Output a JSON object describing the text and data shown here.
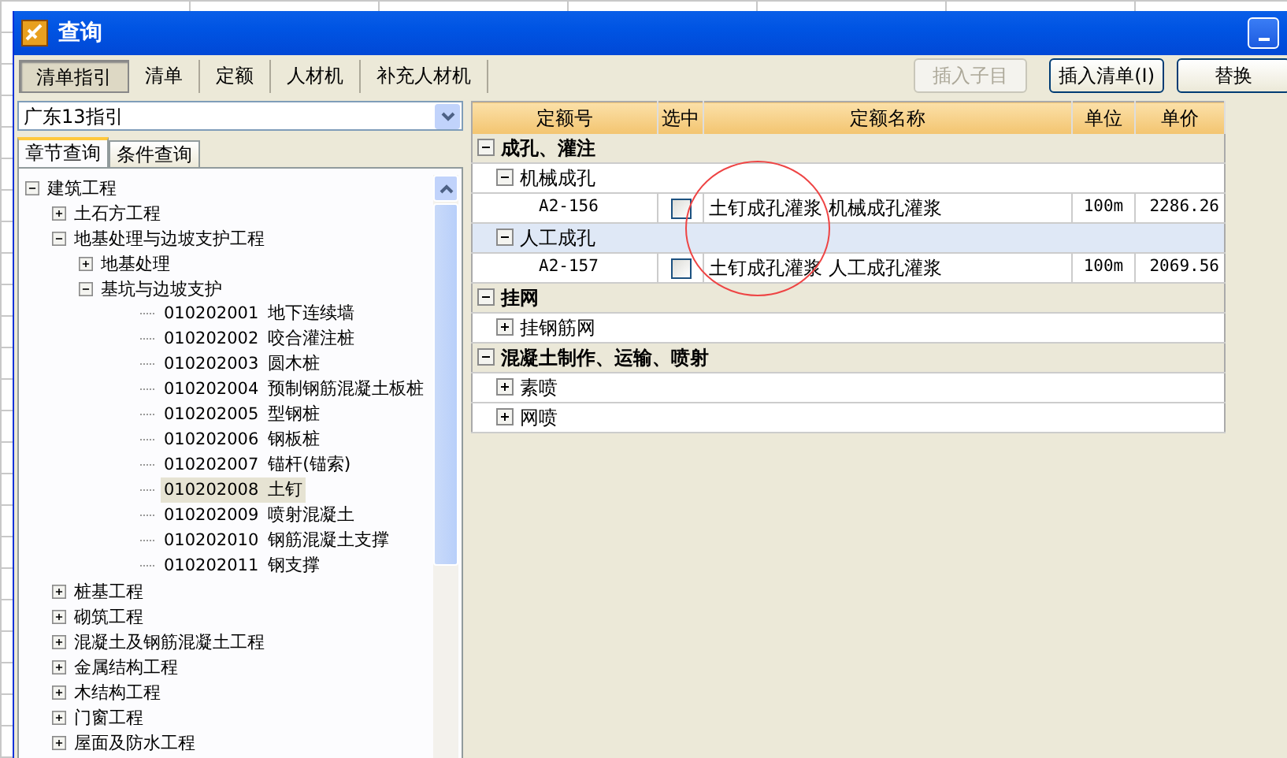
{
  "window": {
    "title": "查询"
  },
  "toolbar_tabs": [
    {
      "label": "清单指引",
      "selected": true
    },
    {
      "label": "清单",
      "selected": false
    },
    {
      "label": "定额",
      "selected": false
    },
    {
      "label": "人材机",
      "selected": false
    },
    {
      "label": "补充人材机",
      "selected": false
    }
  ],
  "toolbar_buttons": [
    {
      "label": "插入子目",
      "disabled": true
    },
    {
      "label": "插入清单(I)",
      "disabled": false
    },
    {
      "label": "替换",
      "disabled": false
    }
  ],
  "library_select": {
    "value": "广东13指引"
  },
  "search_tabs": [
    {
      "label": "章节查询",
      "selected": true
    },
    {
      "label": "条件查询",
      "selected": false
    }
  ],
  "tree": [
    {
      "label": "建筑工程",
      "expanded": true,
      "selected": false,
      "children": [
        {
          "label": "土石方工程",
          "expanded": false,
          "selected": false
        },
        {
          "label": "地基处理与边坡支护工程",
          "expanded": true,
          "selected": false,
          "children": [
            {
              "label": "地基处理",
              "expanded": false,
              "selected": false
            },
            {
              "label": "基坑与边坡支护",
              "expanded": true,
              "selected": false,
              "children": [
                {
                  "code": "010202001",
                  "label": "地下连续墙",
                  "selected": false
                },
                {
                  "code": "010202002",
                  "label": "咬合灌注桩",
                  "selected": false
                },
                {
                  "code": "010202003",
                  "label": "圆木桩",
                  "selected": false
                },
                {
                  "code": "010202004",
                  "label": "预制钢筋混凝土板桩",
                  "selected": false
                },
                {
                  "code": "010202005",
                  "label": "型钢桩",
                  "selected": false
                },
                {
                  "code": "010202006",
                  "label": "钢板桩",
                  "selected": false
                },
                {
                  "code": "010202007",
                  "label": "锚杆(锚索)",
                  "selected": false
                },
                {
                  "code": "010202008",
                  "label": "土钉",
                  "selected": true
                },
                {
                  "code": "010202009",
                  "label": "喷射混凝土",
                  "selected": false
                },
                {
                  "code": "010202010",
                  "label": "钢筋混凝土支撑",
                  "selected": false
                },
                {
                  "code": "010202011",
                  "label": "钢支撑",
                  "selected": false
                }
              ]
            }
          ]
        },
        {
          "label": "桩基工程",
          "expanded": false,
          "selected": false
        },
        {
          "label": "砌筑工程",
          "expanded": false,
          "selected": false
        },
        {
          "label": "混凝土及钢筋混凝土工程",
          "expanded": false,
          "selected": false
        },
        {
          "label": "金属结构工程",
          "expanded": false,
          "selected": false
        },
        {
          "label": "木结构工程",
          "expanded": false,
          "selected": false
        },
        {
          "label": "门窗工程",
          "expanded": false,
          "selected": false
        },
        {
          "label": "屋面及防水工程",
          "expanded": false,
          "selected": false
        }
      ]
    }
  ],
  "table": {
    "columns": [
      "定额号",
      "选中",
      "定额名称",
      "单位",
      "单价"
    ],
    "rows": [
      {
        "kind": "group",
        "label": "成孔、灌注",
        "expanded": true,
        "selected": false
      },
      {
        "kind": "subgroup",
        "label": "机械成孔",
        "expanded": true,
        "selected": false
      },
      {
        "kind": "item",
        "code": "A2-156",
        "checked": false,
        "name": "土钉成孔灌浆 机械成孔灌浆",
        "unit": "100m",
        "price": "2286.26",
        "selected": false
      },
      {
        "kind": "subgroup",
        "label": "人工成孔",
        "expanded": true,
        "selected": true
      },
      {
        "kind": "item",
        "code": "A2-157",
        "checked": false,
        "name": "土钉成孔灌浆 人工成孔灌浆",
        "unit": "100m",
        "price": "2069.56",
        "selected": false
      },
      {
        "kind": "group",
        "label": "挂网",
        "expanded": true,
        "selected": false
      },
      {
        "kind": "subgroup",
        "label": "挂钢筋网",
        "expanded": false,
        "selected": false
      },
      {
        "kind": "group",
        "label": "混凝土制作、运输、喷射",
        "expanded": true,
        "selected": false
      },
      {
        "kind": "subgroup",
        "label": "素喷",
        "expanded": false,
        "selected": false
      },
      {
        "kind": "subgroup",
        "label": "网喷",
        "expanded": false,
        "selected": false
      }
    ]
  }
}
